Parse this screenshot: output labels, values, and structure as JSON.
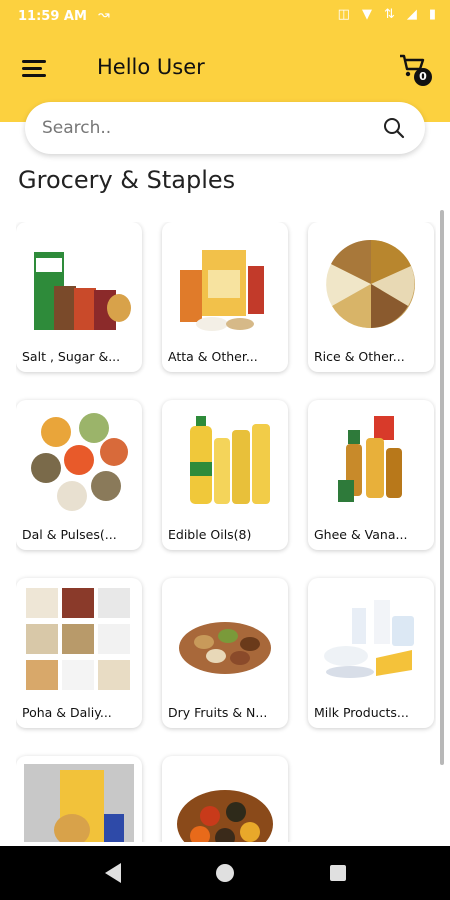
{
  "status_bar": {
    "time": "11:59 AM"
  },
  "header": {
    "title": "Hello User",
    "cart_count": "0"
  },
  "search": {
    "placeholder": "Search.."
  },
  "section": {
    "title": "Grocery & Staples"
  },
  "categories": [
    {
      "label": "Salt , Sugar &...",
      "icon": "salt-sugar-packets-image"
    },
    {
      "label": "Atta & Other...",
      "icon": "atta-flour-bags-image"
    },
    {
      "label": "Rice & Other...",
      "icon": "rice-grains-image"
    },
    {
      "label": "Dal & Pulses(...",
      "icon": "dal-pulses-image"
    },
    {
      "label": "Edible Oils(8)",
      "icon": "oil-bottles-image"
    },
    {
      "label": "Ghee & Vana...",
      "icon": "ghee-jars-image"
    },
    {
      "label": "Poha & Daliy...",
      "icon": "poha-grains-image"
    },
    {
      "label": "Dry Fruits & N...",
      "icon": "dry-fruits-image"
    },
    {
      "label": "Milk Products...",
      "icon": "milk-products-image"
    },
    {
      "label": "",
      "icon": "pet-food-image"
    },
    {
      "label": "",
      "icon": "spice-box-image"
    }
  ],
  "colors": {
    "accent": "#fcd13f",
    "text": "#111111"
  }
}
